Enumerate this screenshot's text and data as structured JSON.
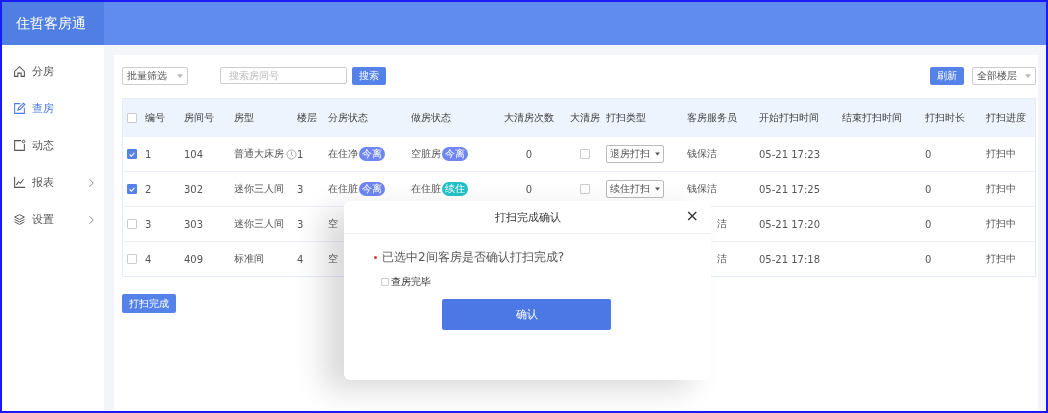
{
  "app": {
    "title": "住哲客房通"
  },
  "sidebar": {
    "items": [
      {
        "label": "分房",
        "selected": false,
        "expandable": false
      },
      {
        "label": "查房",
        "selected": true,
        "expandable": false
      },
      {
        "label": "动态",
        "selected": false,
        "expandable": false
      },
      {
        "label": "报表",
        "selected": false,
        "expandable": true
      },
      {
        "label": "设置",
        "selected": false,
        "expandable": true
      }
    ]
  },
  "toolbar": {
    "batch_filter": "批量筛选",
    "search": {
      "placeholder": "搜索房间号"
    },
    "search_button": "搜索",
    "refresh_button": "刷新",
    "floor_filter": "全部楼层"
  },
  "table": {
    "all_checked": false,
    "columns": [
      "编号",
      "房间号",
      "房型",
      "楼层",
      "分房状态",
      "做房状态",
      "大清房次数",
      "大清房",
      "打扫类型",
      "客房服务员",
      "开始打扫时间",
      "结束打扫时间",
      "打扫时长",
      "打扫进度"
    ],
    "rows": [
      {
        "selected": true,
        "no": "1",
        "room": "104",
        "type": "普通大床房",
        "clock": true,
        "floor": "1",
        "assign_status": "在住净",
        "assign_tag": {
          "text": "今离",
          "color": "#6f86f2"
        },
        "clean_status": "空脏房",
        "clean_tag": {
          "text": "今离",
          "color": "#6f86f2"
        },
        "deep_count": "0",
        "deep_clean": false,
        "clean_type": "退房打扫",
        "staff": "钱保洁",
        "start": "05-21 17:23",
        "duration": "0",
        "progress": "打扫中"
      },
      {
        "selected": true,
        "no": "2",
        "room": "302",
        "type": "迷你三人间",
        "clock": false,
        "floor": "3",
        "assign_status": "在住脏",
        "assign_tag": {
          "text": "今离",
          "color": "#6f86f2"
        },
        "clean_status": "在住脏",
        "clean_tag": {
          "text": "续住",
          "color": "#22c1c9"
        },
        "deep_count": "0",
        "deep_clean": false,
        "clean_type": "续住打扫",
        "staff": "钱保洁",
        "start": "05-21 17:25",
        "duration": "0",
        "progress": "打扫中"
      },
      {
        "selected": false,
        "no": "3",
        "room": "303",
        "type": "迷你三人间",
        "clock": false,
        "floor": "3",
        "assign_status": "空",
        "staff": "洁",
        "start": "05-21 17:20",
        "duration": "0",
        "progress": "打扫中"
      },
      {
        "selected": false,
        "no": "4",
        "room": "409",
        "type": "标准间",
        "clock": false,
        "floor": "4",
        "assign_status": "空",
        "staff": "洁",
        "start": "05-21 17:18",
        "duration": "0",
        "progress": "打扫中"
      }
    ]
  },
  "finish_button": "打扫完成",
  "dialog": {
    "title": "打扫完成确认",
    "close": "×",
    "message": "已选中2间客房是否确认打扫完成?",
    "inspect": {
      "label": "查房完毕",
      "checked": false
    },
    "confirm_button": "确认"
  }
}
